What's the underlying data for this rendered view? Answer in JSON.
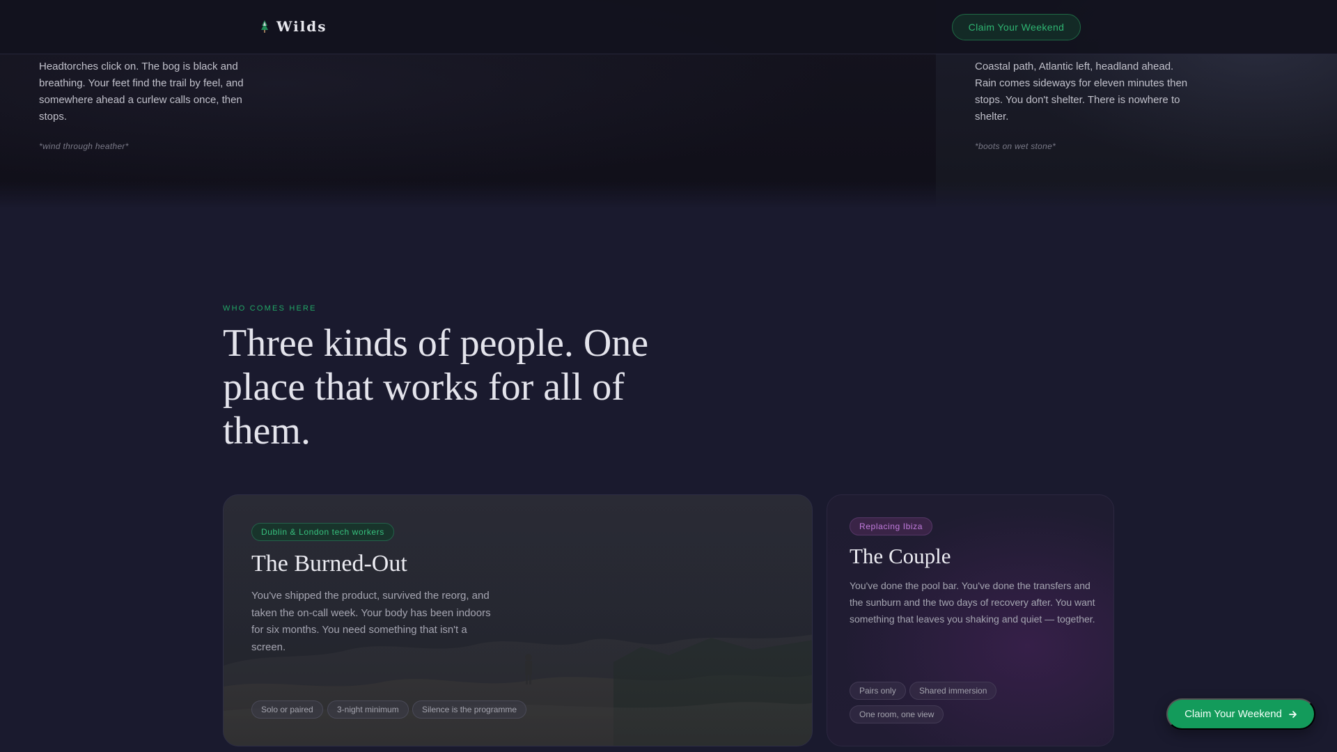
{
  "nav": {
    "brand": "Wilds",
    "cta_label": "Claim Your Weekend"
  },
  "hero": {
    "left_text": "Headtorches click on. The bog is black and breathing. Your feet find the trail by feel, and somewhere ahead a curlew calls once, then stops.",
    "left_sound": "*wind through heather*",
    "right_text": "Coastal path, Atlantic left, headland ahead. Rain comes sideways for eleven minutes then stops. You don't shelter. There is nowhere to shelter.",
    "right_sound": "*boots on wet stone*"
  },
  "section": {
    "eyebrow": "Who comes here",
    "headline": "Three kinds of people. One place that works for all of them."
  },
  "cards": [
    {
      "tag": "Dublin & London tech workers",
      "title": "The Burned-Out",
      "body": "You've shipped the product, survived the reorg, and taken the on-call week. Your body has been indoors for six months. You need something that isn't a screen.",
      "chips": [
        "Solo or paired",
        "3-night minimum",
        "Silence is the programme"
      ]
    },
    {
      "tag": "Replacing Ibiza",
      "title": "The Couple",
      "body": "You've done the pool bar. You've done the transfers and the sunburn and the two days of recovery after. You want something that leaves you shaking and quiet — together.",
      "chips": [
        "Pairs only",
        "Shared immersion",
        "One room, one view"
      ]
    }
  ],
  "floating_cta": {
    "label": "Claim Your Weekend",
    "icon": "arrow-right-icon"
  },
  "colors": {
    "accent_green": "#139b5b",
    "background": "#1a1a2e",
    "purple_tag": "#c27bdd"
  }
}
